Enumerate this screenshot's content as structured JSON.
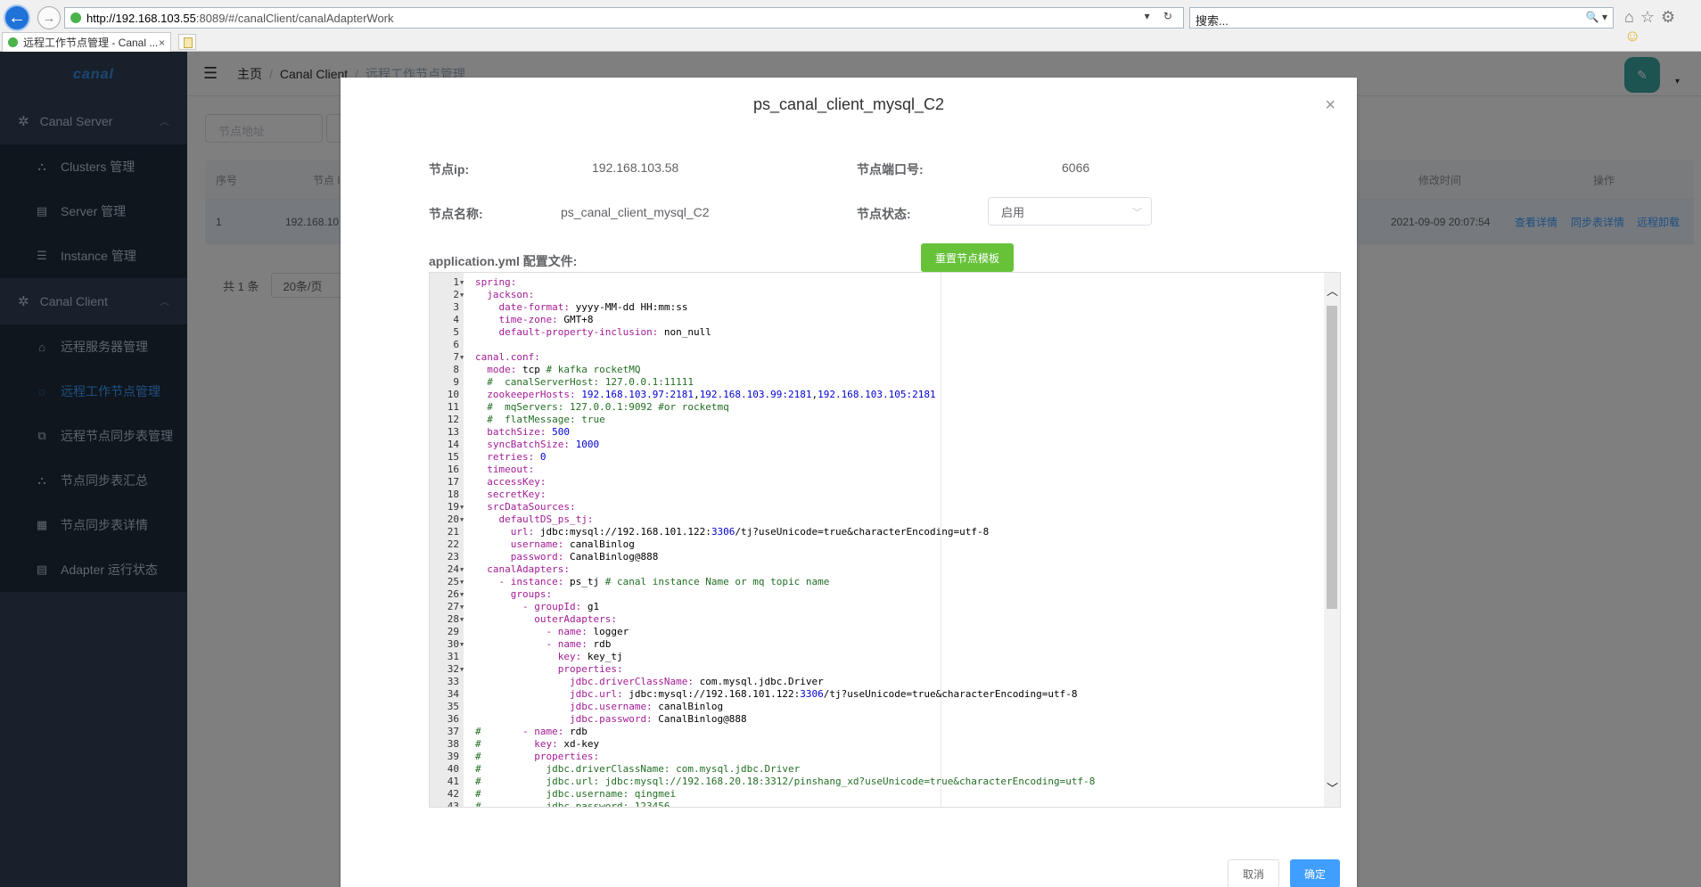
{
  "browser": {
    "url_host": "http://192.168.103.55",
    "url_path": ":8089/#/canalClient/canalAdapterWork",
    "url_tools": "▾ ↻",
    "search_placeholder": "搜索...",
    "search_tools": "🔍 ▾",
    "tab_title": "远程工作节点管理 - Canal ...",
    "tab_close": "×"
  },
  "app": {
    "logo": "canal",
    "menu_groups": [
      {
        "label": "Canal Server",
        "icon": "gear-icon"
      },
      {
        "label": "Canal Client",
        "icon": "gear-icon"
      }
    ],
    "server_items": [
      {
        "label": "Clusters 管理",
        "icon": "cluster-icon"
      },
      {
        "label": "Server 管理",
        "icon": "server-icon"
      },
      {
        "label": "Instance 管理",
        "icon": "list-icon"
      }
    ],
    "client_items": [
      {
        "label": "远程服务器管理",
        "icon": "home-icon"
      },
      {
        "label": "远程工作节点管理",
        "icon": "chat-icon"
      },
      {
        "label": "远程节点同步表管理",
        "icon": "external-link-icon"
      },
      {
        "label": "节点同步表汇总",
        "icon": "cluster-icon"
      },
      {
        "label": "节点同步表详情",
        "icon": "grid-icon"
      },
      {
        "label": "Adapter 运行状态",
        "icon": "document-icon"
      }
    ],
    "breadcrumb": {
      "home": "主页",
      "parent": "Canal Client",
      "current": "远程工作节点管理"
    },
    "filter_placeholder": "节点地址",
    "table": {
      "headers": {
        "index": "序号",
        "node": "节点 I",
        "modified": "修改时间",
        "actions": "操作"
      },
      "row": {
        "index": "1",
        "node": "192.168.10",
        "modified": "2021-09-09 20:07:54",
        "actions": [
          "查看详情",
          "同步表详情",
          "远程卸载"
        ]
      }
    },
    "pager": {
      "total": "共 1 条",
      "size": "20条/页"
    }
  },
  "dialog": {
    "title": "ps_canal_client_mysql_C2",
    "close": "×",
    "ip_label": "节点ip:",
    "ip_value": "192.168.103.58",
    "port_label": "节点端口号:",
    "port_value": "6066",
    "name_label": "节点名称:",
    "name_value": "ps_canal_client_mysql_C2",
    "status_label": "节点状态:",
    "status_value": "启用",
    "config_label": "application.yml 配置文件:",
    "reset_button": "重置节点模板",
    "cancel_button": "取消",
    "ok_button": "确定",
    "code_lines": [
      {
        "n": "1",
        "f": true,
        "seg": [
          [
            "k",
            "spring:"
          ]
        ]
      },
      {
        "n": "2",
        "f": true,
        "seg": [
          [
            "s",
            "  "
          ],
          [
            "k",
            "jackson:"
          ]
        ]
      },
      {
        "n": "3",
        "f": false,
        "seg": [
          [
            "s",
            "    "
          ],
          [
            "k",
            "date-format:"
          ],
          [
            "s",
            " yyyy-MM-dd HH:mm:ss"
          ]
        ]
      },
      {
        "n": "4",
        "f": false,
        "seg": [
          [
            "s",
            "    "
          ],
          [
            "k",
            "time-zone:"
          ],
          [
            "s",
            " GMT+8"
          ]
        ]
      },
      {
        "n": "5",
        "f": false,
        "seg": [
          [
            "s",
            "    "
          ],
          [
            "k",
            "default-property-inclusion:"
          ],
          [
            "s",
            " non_null"
          ]
        ]
      },
      {
        "n": "6",
        "f": false,
        "seg": []
      },
      {
        "n": "7",
        "f": true,
        "seg": [
          [
            "k",
            "canal.conf:"
          ]
        ]
      },
      {
        "n": "8",
        "f": false,
        "seg": [
          [
            "s",
            "  "
          ],
          [
            "k",
            "mode:"
          ],
          [
            "s",
            " tcp "
          ],
          [
            "c",
            "# kafka rocketMQ"
          ]
        ]
      },
      {
        "n": "9",
        "f": false,
        "seg": [
          [
            "s",
            "  "
          ],
          [
            "c",
            "#  canalServerHost: 127.0.0.1:11111"
          ]
        ]
      },
      {
        "n": "10",
        "f": false,
        "seg": [
          [
            "s",
            "  "
          ],
          [
            "k",
            "zookeeperHosts:"
          ],
          [
            "s",
            " "
          ],
          [
            "n",
            "192.168.103.97:2181"
          ],
          [
            "s",
            ","
          ],
          [
            "n",
            "192.168.103.99:2181"
          ],
          [
            "s",
            ","
          ],
          [
            "n",
            "192.168.103.105:2181"
          ]
        ]
      },
      {
        "n": "11",
        "f": false,
        "seg": [
          [
            "s",
            "  "
          ],
          [
            "c",
            "#  mqServers: 127.0.0.1:9092 #or rocketmq"
          ]
        ]
      },
      {
        "n": "12",
        "f": false,
        "seg": [
          [
            "s",
            "  "
          ],
          [
            "c",
            "#  flatMessage: true"
          ]
        ]
      },
      {
        "n": "13",
        "f": false,
        "seg": [
          [
            "s",
            "  "
          ],
          [
            "k",
            "batchSize:"
          ],
          [
            "s",
            " "
          ],
          [
            "n",
            "500"
          ]
        ]
      },
      {
        "n": "14",
        "f": false,
        "seg": [
          [
            "s",
            "  "
          ],
          [
            "k",
            "syncBatchSize:"
          ],
          [
            "s",
            " "
          ],
          [
            "n",
            "1000"
          ]
        ]
      },
      {
        "n": "15",
        "f": false,
        "seg": [
          [
            "s",
            "  "
          ],
          [
            "k",
            "retries:"
          ],
          [
            "s",
            " "
          ],
          [
            "n",
            "0"
          ]
        ]
      },
      {
        "n": "16",
        "f": false,
        "seg": [
          [
            "s",
            "  "
          ],
          [
            "k",
            "timeout:"
          ]
        ]
      },
      {
        "n": "17",
        "f": false,
        "seg": [
          [
            "s",
            "  "
          ],
          [
            "k",
            "accessKey:"
          ]
        ]
      },
      {
        "n": "18",
        "f": false,
        "seg": [
          [
            "s",
            "  "
          ],
          [
            "k",
            "secretKey:"
          ]
        ]
      },
      {
        "n": "19",
        "f": true,
        "seg": [
          [
            "s",
            "  "
          ],
          [
            "k",
            "srcDataSources:"
          ]
        ]
      },
      {
        "n": "20",
        "f": true,
        "seg": [
          [
            "s",
            "    "
          ],
          [
            "k",
            "defaultDS_ps_tj:"
          ]
        ]
      },
      {
        "n": "21",
        "f": false,
        "seg": [
          [
            "s",
            "      "
          ],
          [
            "k",
            "url:"
          ],
          [
            "s",
            " jdbc:mysql://192.168.101.122:"
          ],
          [
            "n",
            "3306"
          ],
          [
            "s",
            "/tj?useUnicode=true&characterEncoding=utf-8"
          ]
        ]
      },
      {
        "n": "22",
        "f": false,
        "seg": [
          [
            "s",
            "      "
          ],
          [
            "k",
            "username:"
          ],
          [
            "s",
            " canalBinlog"
          ]
        ]
      },
      {
        "n": "23",
        "f": false,
        "seg": [
          [
            "s",
            "      "
          ],
          [
            "k",
            "password:"
          ],
          [
            "s",
            " CanalBinlog@888"
          ]
        ]
      },
      {
        "n": "24",
        "f": true,
        "seg": [
          [
            "s",
            "  "
          ],
          [
            "k",
            "canalAdapters:"
          ]
        ]
      },
      {
        "n": "25",
        "f": true,
        "seg": [
          [
            "s",
            "    "
          ],
          [
            "k",
            "- instance:"
          ],
          [
            "s",
            " ps_tj "
          ],
          [
            "c",
            "# canal instance Name or mq topic name"
          ]
        ]
      },
      {
        "n": "26",
        "f": true,
        "seg": [
          [
            "s",
            "      "
          ],
          [
            "k",
            "groups:"
          ]
        ]
      },
      {
        "n": "27",
        "f": true,
        "seg": [
          [
            "s",
            "        "
          ],
          [
            "k",
            "- groupId:"
          ],
          [
            "s",
            " g1"
          ]
        ]
      },
      {
        "n": "28",
        "f": true,
        "seg": [
          [
            "s",
            "          "
          ],
          [
            "k",
            "outerAdapters:"
          ]
        ]
      },
      {
        "n": "29",
        "f": false,
        "seg": [
          [
            "s",
            "            "
          ],
          [
            "k",
            "- name:"
          ],
          [
            "s",
            " logger"
          ]
        ]
      },
      {
        "n": "30",
        "f": true,
        "seg": [
          [
            "s",
            "            "
          ],
          [
            "k",
            "- name:"
          ],
          [
            "s",
            " rdb"
          ]
        ]
      },
      {
        "n": "31",
        "f": false,
        "seg": [
          [
            "s",
            "              "
          ],
          [
            "k",
            "key:"
          ],
          [
            "s",
            " key_tj"
          ]
        ]
      },
      {
        "n": "32",
        "f": true,
        "seg": [
          [
            "s",
            "              "
          ],
          [
            "k",
            "properties:"
          ]
        ]
      },
      {
        "n": "33",
        "f": false,
        "seg": [
          [
            "s",
            "                "
          ],
          [
            "k",
            "jdbc.driverClassName:"
          ],
          [
            "s",
            " com.mysql.jdbc.Driver"
          ]
        ]
      },
      {
        "n": "34",
        "f": false,
        "seg": [
          [
            "s",
            "                "
          ],
          [
            "k",
            "jdbc.url:"
          ],
          [
            "s",
            " jdbc:mysql://192.168.101.122:"
          ],
          [
            "n",
            "3306"
          ],
          [
            "s",
            "/tj?useUnicode=true&characterEncoding=utf-8"
          ]
        ]
      },
      {
        "n": "35",
        "f": false,
        "seg": [
          [
            "s",
            "                "
          ],
          [
            "k",
            "jdbc.username:"
          ],
          [
            "s",
            " canalBinlog"
          ]
        ]
      },
      {
        "n": "36",
        "f": false,
        "seg": [
          [
            "s",
            "                "
          ],
          [
            "k",
            "jdbc.password:"
          ],
          [
            "s",
            " CanalBinlog@888"
          ]
        ]
      },
      {
        "n": "37",
        "f": false,
        "seg": [
          [
            "c",
            "#"
          ],
          [
            "s",
            "       "
          ],
          [
            "k",
            "- name:"
          ],
          [
            "s",
            " rdb"
          ]
        ]
      },
      {
        "n": "38",
        "f": false,
        "seg": [
          [
            "c",
            "#"
          ],
          [
            "s",
            "         "
          ],
          [
            "k",
            "key:"
          ],
          [
            "s",
            " xd-key"
          ]
        ]
      },
      {
        "n": "39",
        "f": false,
        "seg": [
          [
            "c",
            "#"
          ],
          [
            "s",
            "         "
          ],
          [
            "k",
            "properties:"
          ]
        ]
      },
      {
        "n": "40",
        "f": false,
        "seg": [
          [
            "c",
            "#           jdbc.driverClassName: com.mysql.jdbc.Driver"
          ]
        ]
      },
      {
        "n": "41",
        "f": false,
        "seg": [
          [
            "c",
            "#           jdbc.url: jdbc:mysql://192.168.20.18:3312/pinshang_xd?useUnicode=true&characterEncoding=utf-8"
          ]
        ]
      },
      {
        "n": "42",
        "f": false,
        "seg": [
          [
            "c",
            "#           jdbc.username: qingmei"
          ]
        ]
      },
      {
        "n": "43",
        "f": false,
        "seg": [
          [
            "c",
            "#           jdbc.password: 123456"
          ]
        ]
      }
    ]
  }
}
